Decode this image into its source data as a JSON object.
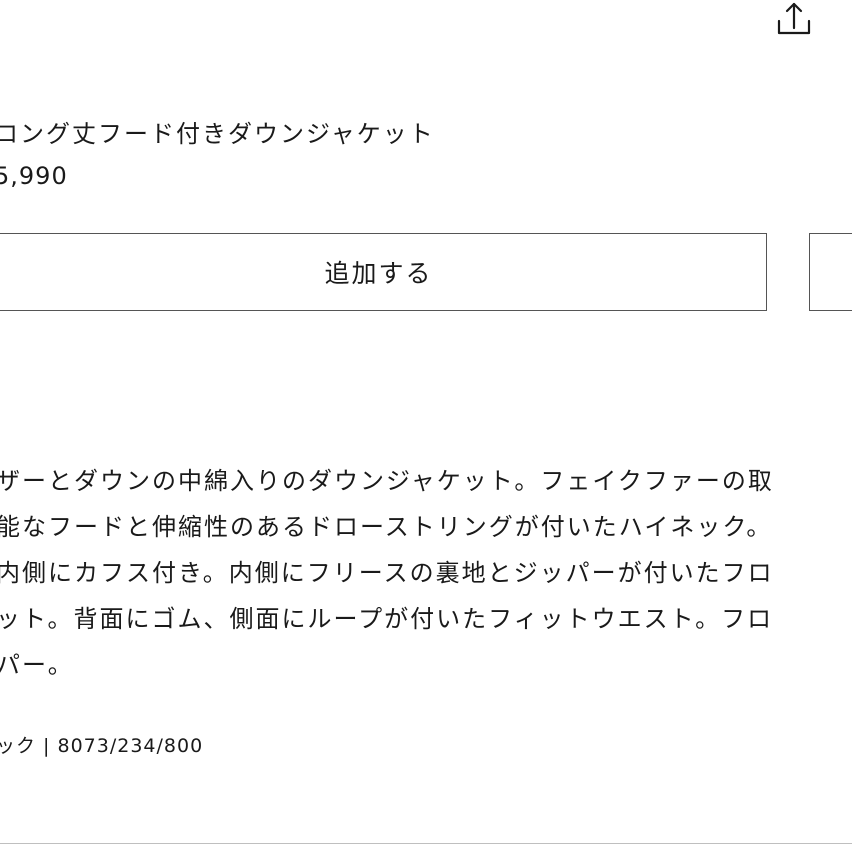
{
  "header": {
    "share_icon": "share-upload-icon"
  },
  "product": {
    "title": "ロング丈フード付きダウンジャケット",
    "price": "5,990"
  },
  "actions": {
    "add_label": "追加する",
    "secondary_icon": "bookmark-icon"
  },
  "description": {
    "lines": [
      "ザーとダウンの中綿入りのダウンジャケット。フェイクファーの取",
      "能なフードと伸縮性のあるドローストリングが付いたハイネック。",
      "内側にカフス付き。内側にフリースの裏地とジッパーが付いたフロ",
      "ット。背面にゴム、側面にループが付いたフィットウエスト。フロ",
      "パー。"
    ]
  },
  "reference": {
    "text": "ック | 8073/234/800"
  },
  "colors": {
    "text": "#1a1a1a",
    "border": "#555555",
    "background": "#ffffff",
    "divider": "#bfbfbf"
  }
}
